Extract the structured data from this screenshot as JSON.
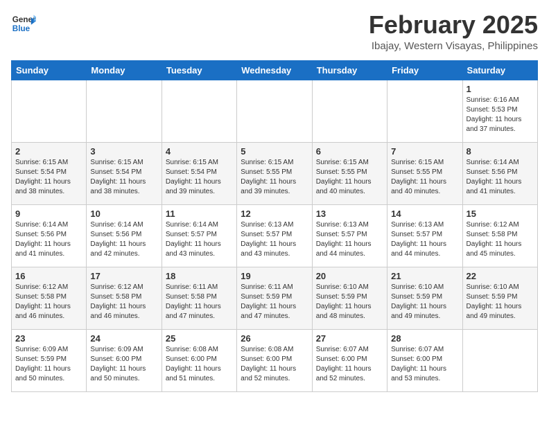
{
  "header": {
    "logo_general": "General",
    "logo_blue": "Blue",
    "month_year": "February 2025",
    "location": "Ibajay, Western Visayas, Philippines"
  },
  "weekdays": [
    "Sunday",
    "Monday",
    "Tuesday",
    "Wednesday",
    "Thursday",
    "Friday",
    "Saturday"
  ],
  "weeks": [
    [
      {
        "day": "",
        "info": ""
      },
      {
        "day": "",
        "info": ""
      },
      {
        "day": "",
        "info": ""
      },
      {
        "day": "",
        "info": ""
      },
      {
        "day": "",
        "info": ""
      },
      {
        "day": "",
        "info": ""
      },
      {
        "day": "1",
        "info": "Sunrise: 6:16 AM\nSunset: 5:53 PM\nDaylight: 11 hours\nand 37 minutes."
      }
    ],
    [
      {
        "day": "2",
        "info": "Sunrise: 6:15 AM\nSunset: 5:54 PM\nDaylight: 11 hours\nand 38 minutes."
      },
      {
        "day": "3",
        "info": "Sunrise: 6:15 AM\nSunset: 5:54 PM\nDaylight: 11 hours\nand 38 minutes."
      },
      {
        "day": "4",
        "info": "Sunrise: 6:15 AM\nSunset: 5:54 PM\nDaylight: 11 hours\nand 39 minutes."
      },
      {
        "day": "5",
        "info": "Sunrise: 6:15 AM\nSunset: 5:55 PM\nDaylight: 11 hours\nand 39 minutes."
      },
      {
        "day": "6",
        "info": "Sunrise: 6:15 AM\nSunset: 5:55 PM\nDaylight: 11 hours\nand 40 minutes."
      },
      {
        "day": "7",
        "info": "Sunrise: 6:15 AM\nSunset: 5:55 PM\nDaylight: 11 hours\nand 40 minutes."
      },
      {
        "day": "8",
        "info": "Sunrise: 6:14 AM\nSunset: 5:56 PM\nDaylight: 11 hours\nand 41 minutes."
      }
    ],
    [
      {
        "day": "9",
        "info": "Sunrise: 6:14 AM\nSunset: 5:56 PM\nDaylight: 11 hours\nand 41 minutes."
      },
      {
        "day": "10",
        "info": "Sunrise: 6:14 AM\nSunset: 5:56 PM\nDaylight: 11 hours\nand 42 minutes."
      },
      {
        "day": "11",
        "info": "Sunrise: 6:14 AM\nSunset: 5:57 PM\nDaylight: 11 hours\nand 43 minutes."
      },
      {
        "day": "12",
        "info": "Sunrise: 6:13 AM\nSunset: 5:57 PM\nDaylight: 11 hours\nand 43 minutes."
      },
      {
        "day": "13",
        "info": "Sunrise: 6:13 AM\nSunset: 5:57 PM\nDaylight: 11 hours\nand 44 minutes."
      },
      {
        "day": "14",
        "info": "Sunrise: 6:13 AM\nSunset: 5:57 PM\nDaylight: 11 hours\nand 44 minutes."
      },
      {
        "day": "15",
        "info": "Sunrise: 6:12 AM\nSunset: 5:58 PM\nDaylight: 11 hours\nand 45 minutes."
      }
    ],
    [
      {
        "day": "16",
        "info": "Sunrise: 6:12 AM\nSunset: 5:58 PM\nDaylight: 11 hours\nand 46 minutes."
      },
      {
        "day": "17",
        "info": "Sunrise: 6:12 AM\nSunset: 5:58 PM\nDaylight: 11 hours\nand 46 minutes."
      },
      {
        "day": "18",
        "info": "Sunrise: 6:11 AM\nSunset: 5:58 PM\nDaylight: 11 hours\nand 47 minutes."
      },
      {
        "day": "19",
        "info": "Sunrise: 6:11 AM\nSunset: 5:59 PM\nDaylight: 11 hours\nand 47 minutes."
      },
      {
        "day": "20",
        "info": "Sunrise: 6:10 AM\nSunset: 5:59 PM\nDaylight: 11 hours\nand 48 minutes."
      },
      {
        "day": "21",
        "info": "Sunrise: 6:10 AM\nSunset: 5:59 PM\nDaylight: 11 hours\nand 49 minutes."
      },
      {
        "day": "22",
        "info": "Sunrise: 6:10 AM\nSunset: 5:59 PM\nDaylight: 11 hours\nand 49 minutes."
      }
    ],
    [
      {
        "day": "23",
        "info": "Sunrise: 6:09 AM\nSunset: 5:59 PM\nDaylight: 11 hours\nand 50 minutes."
      },
      {
        "day": "24",
        "info": "Sunrise: 6:09 AM\nSunset: 6:00 PM\nDaylight: 11 hours\nand 50 minutes."
      },
      {
        "day": "25",
        "info": "Sunrise: 6:08 AM\nSunset: 6:00 PM\nDaylight: 11 hours\nand 51 minutes."
      },
      {
        "day": "26",
        "info": "Sunrise: 6:08 AM\nSunset: 6:00 PM\nDaylight: 11 hours\nand 52 minutes."
      },
      {
        "day": "27",
        "info": "Sunrise: 6:07 AM\nSunset: 6:00 PM\nDaylight: 11 hours\nand 52 minutes."
      },
      {
        "day": "28",
        "info": "Sunrise: 6:07 AM\nSunset: 6:00 PM\nDaylight: 11 hours\nand 53 minutes."
      },
      {
        "day": "",
        "info": ""
      }
    ]
  ]
}
